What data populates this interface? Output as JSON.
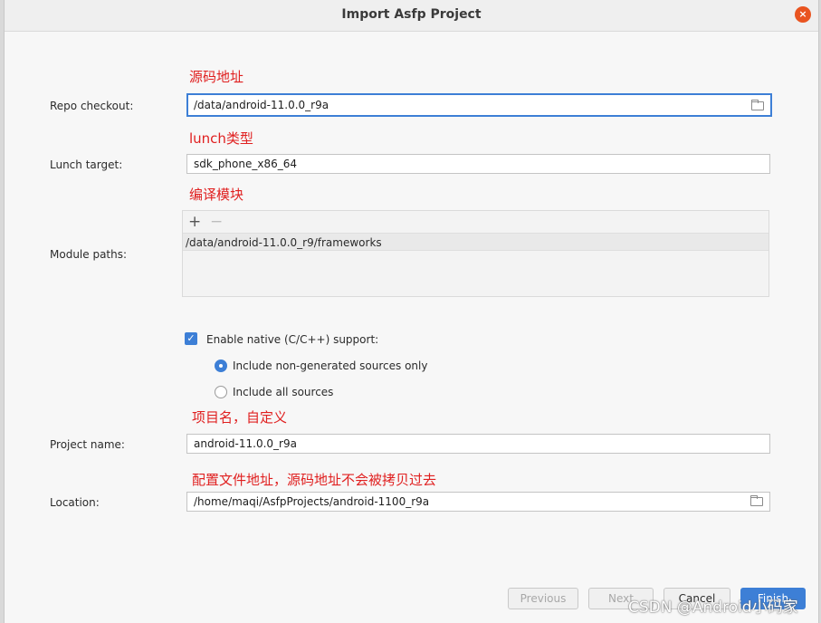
{
  "window": {
    "title": "Import Asfp Project",
    "close_label": "×"
  },
  "annotations": {
    "repo": "源码地址",
    "lunch": "lunch类型",
    "module": "编译模块",
    "project": "项目名，自定义",
    "location": "配置文件地址，源码地址不会被拷贝过去"
  },
  "form": {
    "repo_label": "Repo checkout:",
    "repo_value": "/data/android-11.0.0_r9a",
    "lunch_label": "Lunch target:",
    "lunch_value": "sdk_phone_x86_64",
    "module_label": "Module paths:",
    "module_add": "+",
    "module_remove": "−",
    "module_paths": [
      "/data/android-11.0.0_r9/frameworks"
    ],
    "native_label": "Enable native (C/C++) support:",
    "native_checked": true,
    "radio_options": [
      {
        "label": "Include non-generated sources only",
        "selected": true
      },
      {
        "label": "Include all sources",
        "selected": false
      }
    ],
    "project_label": "Project name:",
    "project_value": "android-11.0.0_r9a",
    "location_label": "Location:",
    "location_value": "/home/maqi/AsfpProjects/android-1100_r9a"
  },
  "buttons": {
    "previous": "Previous",
    "next": "Next",
    "cancel": "Cancel",
    "finish": "Finish"
  },
  "overlay": {
    "csdn": "CSDN @Android小码家"
  },
  "colors": {
    "accent": "#3d7fd6",
    "annotation": "#e02020",
    "close": "#e95420"
  }
}
